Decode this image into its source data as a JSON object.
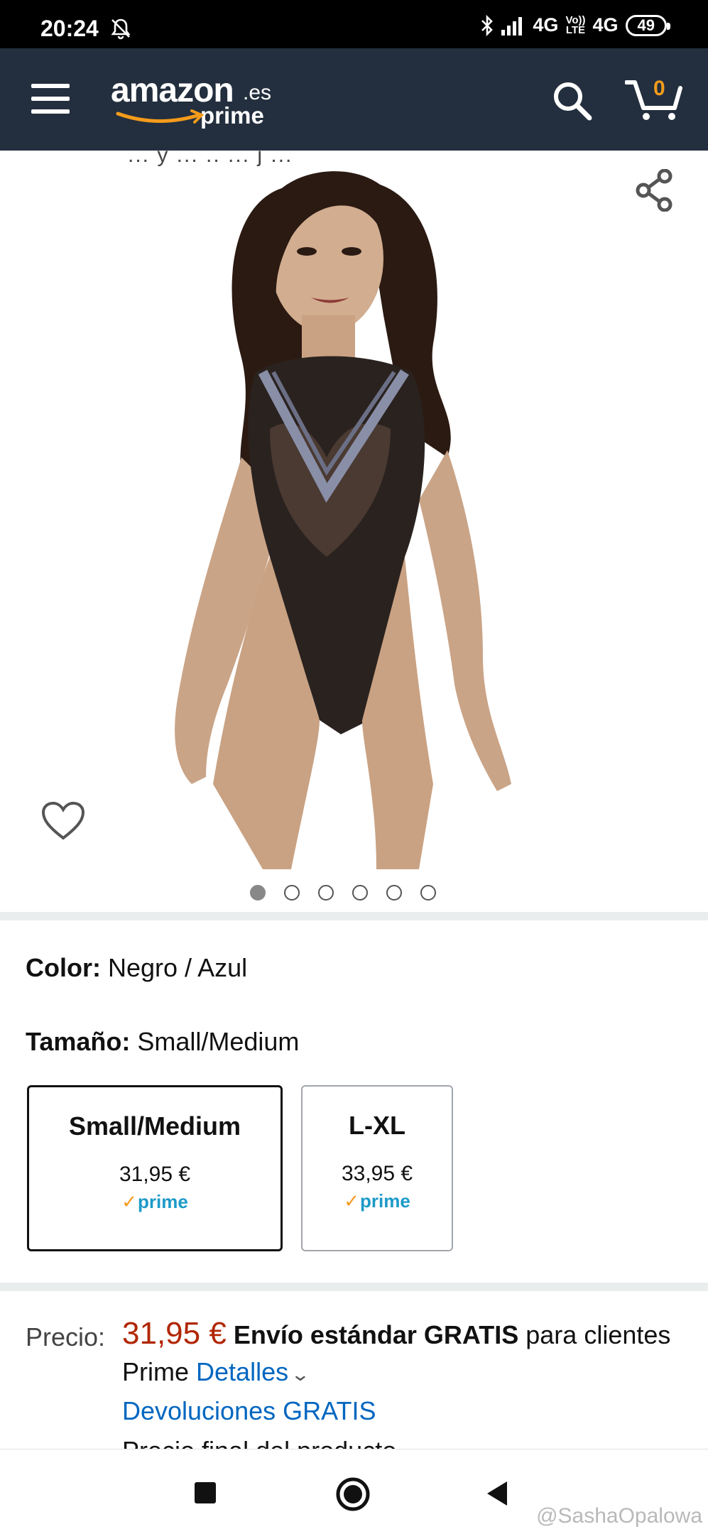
{
  "status_bar": {
    "time": "20:24",
    "network_1": "4G",
    "volte_top": "Vo))",
    "volte_bottom": "LTE",
    "network_2": "4G",
    "battery": "49"
  },
  "header": {
    "logo_main": "amazon",
    "logo_domain": ".es",
    "logo_sub": "prime",
    "cart_count": "0",
    "colors": {
      "background": "#232f3e",
      "cart_accent": "#f59b1b"
    }
  },
  "gallery": {
    "partial_title_text": "... y ... .. ... j ...",
    "image_count": 6,
    "active_index": 0
  },
  "variations": {
    "color_label": "Color:",
    "color_value": "Negro / Azul",
    "size_label": "Tamaño:",
    "size_value": "Small/Medium",
    "options": [
      {
        "name": "Small/Medium",
        "price": "31,95 €",
        "badge": "prime",
        "selected": true
      },
      {
        "name": "L-XL",
        "price": "33,95 €",
        "badge": "prime",
        "selected": false
      }
    ]
  },
  "price": {
    "label": "Precio:",
    "value": "31,95 €",
    "shipping_bold": "Envío estándar GRATIS",
    "shipping_rest": "para clientes Prime",
    "details_link": "Detalles",
    "returns_link": "Devoluciones GRATIS",
    "cut_line": "Precio final del producto",
    "colors": {
      "price": "#b12704",
      "link": "#0066c0"
    }
  },
  "watermark": "@SashaOpalowa"
}
